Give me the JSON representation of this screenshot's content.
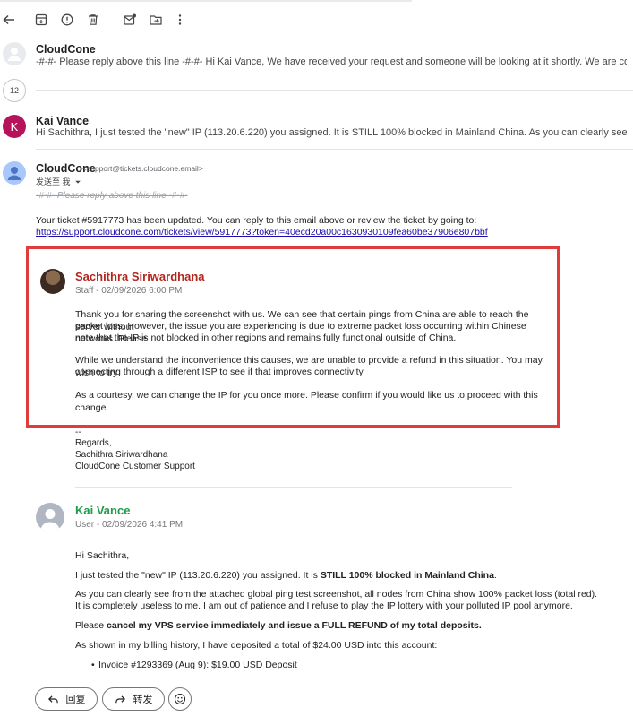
{
  "colors": {
    "highlight_border": "#e03c3c",
    "staff_name": "#b3261e",
    "user_name": "#1e9c4b",
    "avatar_k": "#b5145b",
    "link": "#1a0dab"
  },
  "toolbar": {
    "icons": [
      "back-icon",
      "archive-icon",
      "report-icon",
      "delete-icon",
      "mark-unread-icon",
      "move-to-icon",
      "more-icon"
    ]
  },
  "thread": {
    "msg1": {
      "sender": "CloudCone",
      "snippet": "-#-#- Please reply above this line -#-#- Hi Kai Vance, We have received your request and someone will be looking at it shortly. We are committed to resolving ev"
    },
    "collapsed_count": "12",
    "msg2": {
      "avatar_letter": "K",
      "sender": "Kai Vance",
      "snippet": "Hi Sachithra, I just tested the \"new\" IP (113.20.6.220) you assigned. It is STILL 100% blocked in Mainland China. As you can clearly see from the attached globa"
    },
    "open": {
      "sender": "CloudCone",
      "email": "<support@tickets.cloudcone.email>",
      "to_me": "发送至 我",
      "reply_line": "-#-#- Please reply above this line -#-#-",
      "updated_text": "Your ticket #5917773 has been updated. You can reply to this email above or review the ticket by going to:",
      "link": "https://support.cloudcone.com/tickets/view/5917773?token=40ecd20a00c1630930109fea60be37906e807bbf",
      "staff_reply": {
        "name": "Sachithra Siriwardhana",
        "meta": "Staff - 02/09/2026 6:00 PM",
        "p1_l1": "Thank you for sharing the screenshot with us. We can see that certain pings from China are able to reach the server without",
        "p1_l2": "packet loss. However, the issue you are experiencing is due to extreme packet loss occurring within Chinese networks. Please",
        "p1_l3": "note that the IP is not blocked in other regions and remains fully functional outside of China.",
        "p2_l1": "While we understand the inconvenience this causes, we are unable to provide a refund in this situation. You may wish to try",
        "p2_l2": "connecting through a different ISP to see if that improves connectivity.",
        "p3": "As a courtesy, we can change the IP for you once more. Please confirm if you would like us to proceed with this change."
      },
      "signature": {
        "dashes": "--",
        "regards": "Regards,",
        "name": "Sachithra Siriwardhana",
        "team": "CloudCone Customer Support"
      },
      "user_reply": {
        "name": "Kai Vance",
        "meta": "User - 02/09/2026 4:41 PM",
        "greeting": "Hi Sachithra,",
        "p1_a": "I just tested the \"new\" IP (113.20.6.220) you assigned. It is ",
        "p1_b": "STILL 100% blocked in Mainland China",
        "p1_c": ".",
        "p2_l1": "As you can clearly see from the attached global ping test screenshot, all nodes from China show 100% packet loss (total red).",
        "p2_l2": "It is completely useless to me. I am out of patience and I refuse to play the IP lottery with your polluted IP pool anymore.",
        "p3_a": "Please ",
        "p3_b": "cancel my VPS service immediately and issue a FULL REFUND of my total deposits.",
        "p4": "As shown in my billing history, I have deposited a total of $24.00 USD into this account:",
        "bullet1": "Invoice #1293369 (Aug 9): $19.00 USD Deposit"
      }
    }
  },
  "actions": {
    "reply": "回复",
    "forward": "转发"
  }
}
